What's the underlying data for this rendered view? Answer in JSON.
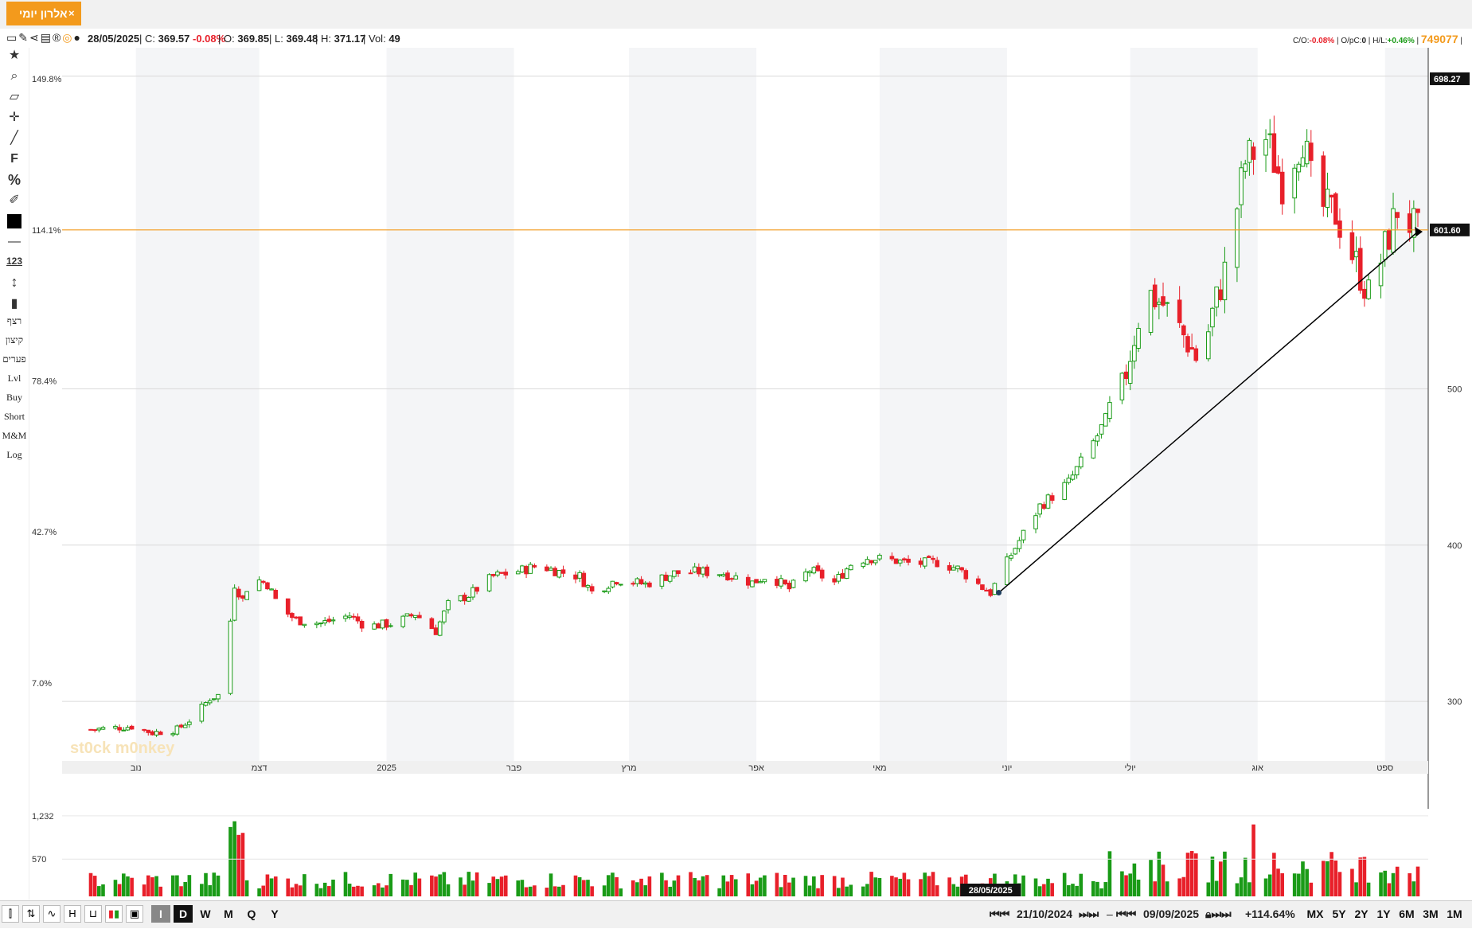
{
  "tab": {
    "title": "אלרון יומי",
    "close": "×"
  },
  "info": {
    "date": "28/05/2025",
    "close_label": "C:",
    "close": "369.57",
    "change": "-0.08%",
    "open_label": "O:",
    "open": "369.85",
    "low_label": "L:",
    "low": "369.48",
    "high_label": "H:",
    "high": "371.17",
    "vol_label": "Vol:",
    "vol": "49",
    "co_label": "C/O:",
    "co": "-0.08%",
    "opc_label": "O/pC:",
    "opc": "0",
    "hl_label": "H/L:",
    "hl": "+0.46%",
    "id": "749077"
  },
  "sidebar": {
    "text_items": [
      "רצף",
      "קיצון",
      "פערים",
      "Lvl",
      "Buy",
      "Short",
      "M&M",
      "Log"
    ],
    "icons": [
      "star-icon",
      "search-icon",
      "eraser-icon",
      "crosshair-icon",
      "line-tool-icon",
      "fibonacci-icon",
      "percent-icon",
      "edit-icon",
      "color-swatch-icon",
      "line-style-icon",
      "numbers-icon",
      "vertical-line-icon",
      "candle-style-icon"
    ],
    "labels": {
      "f": "F",
      "percent": "%",
      "num": "123"
    }
  },
  "bottom": {
    "start_date": "21/10/2024",
    "end_date": "09/09/2025",
    "sep": "–",
    "change": "+114.64%",
    "periods": [
      "MX",
      "5Y",
      "2Y",
      "1Y",
      "6M",
      "3M",
      "1M"
    ],
    "intervals": [
      "I",
      "D",
      "W",
      "M",
      "Q",
      "Y"
    ],
    "left_icons": [
      "candle-chart-icon",
      "bar-chart-icon",
      "line-chart-icon",
      "ohlc-icon",
      "hollow-candle-icon",
      "volume-colors-icon",
      "save-icon"
    ]
  },
  "colors": {
    "up": "#1a9b17",
    "down": "#e8202a",
    "accent": "#f39a1c",
    "grid": "#d9d9d9",
    "band": "#f4f5f7"
  },
  "chart_data": {
    "type": "candlestick",
    "watermark": "st0ck m0nkey",
    "y_pct_ticks": [
      "149.8%",
      "114.1%",
      "78.4%",
      "42.7%",
      "7.0%"
    ],
    "y_price_ticks": [
      700,
      500,
      400,
      300
    ],
    "ylim": [
      268,
      712
    ],
    "price_labels": {
      "last": "698.27",
      "level": "601.60"
    },
    "horizontal_line": 601.6,
    "months": [
      {
        "label": "נוב",
        "date": "2024-11-01"
      },
      {
        "label": "דצמ",
        "date": "2024-12-01"
      },
      {
        "label": "2025",
        "date": "2025-01-01"
      },
      {
        "label": "פבר",
        "date": "2025-02-01"
      },
      {
        "label": "מרץ",
        "date": "2025-03-01"
      },
      {
        "label": "אפר",
        "date": "2025-04-01"
      },
      {
        "label": "מאי",
        "date": "2025-05-01"
      },
      {
        "label": "יוני",
        "date": "2025-06-01"
      },
      {
        "label": "יולי",
        "date": "2025-07-01"
      },
      {
        "label": "אוג",
        "date": "2025-08-01"
      },
      {
        "label": "ספט",
        "date": "2025-09-01"
      }
    ],
    "close_path": [
      [
        "2024-10-21",
        282
      ],
      [
        "2024-10-31",
        284
      ],
      [
        "2024-11-05",
        280
      ],
      [
        "2024-11-11",
        282
      ],
      [
        "2024-11-15",
        290
      ],
      [
        "2024-11-19",
        302
      ],
      [
        "2024-11-22",
        305
      ],
      [
        "2024-11-25",
        375
      ],
      [
        "2024-11-27",
        365
      ],
      [
        "2024-11-29",
        380
      ],
      [
        "2024-12-03",
        375
      ],
      [
        "2024-12-06",
        360
      ],
      [
        "2024-12-10",
        352
      ],
      [
        "2024-12-16",
        350
      ],
      [
        "2024-12-23",
        355
      ],
      [
        "2024-12-27",
        348
      ],
      [
        "2025-01-03",
        350
      ],
      [
        "2025-01-08",
        356
      ],
      [
        "2025-01-13",
        345
      ],
      [
        "2025-01-16",
        362
      ],
      [
        "2025-01-21",
        368
      ],
      [
        "2025-01-27",
        380
      ],
      [
        "2025-02-03",
        384
      ],
      [
        "2025-02-07",
        387
      ],
      [
        "2025-02-12",
        383
      ],
      [
        "2025-02-17",
        380
      ],
      [
        "2025-02-20",
        370
      ],
      [
        "2025-02-26",
        378
      ],
      [
        "2025-03-05",
        375
      ],
      [
        "2025-03-12",
        382
      ],
      [
        "2025-03-18",
        383
      ],
      [
        "2025-03-24",
        382
      ],
      [
        "2025-03-31",
        376
      ],
      [
        "2025-04-04",
        381
      ],
      [
        "2025-04-09",
        372
      ],
      [
        "2025-04-14",
        384
      ],
      [
        "2025-04-20",
        376
      ],
      [
        "2025-04-24",
        388
      ],
      [
        "2025-04-28",
        392
      ],
      [
        "2025-05-05",
        390
      ],
      [
        "2025-05-09",
        388
      ],
      [
        "2025-05-15",
        389
      ],
      [
        "2025-05-20",
        385
      ],
      [
        "2025-05-26",
        373
      ],
      [
        "2025-05-28",
        369.57
      ],
      [
        "2025-06-02",
        394
      ],
      [
        "2025-06-09",
        425
      ],
      [
        "2025-06-16",
        440
      ],
      [
        "2025-06-23",
        470
      ],
      [
        "2025-06-29",
        500
      ],
      [
        "2025-07-03",
        545
      ],
      [
        "2025-07-06",
        560
      ],
      [
        "2025-07-09",
        554
      ],
      [
        "2025-07-15",
        530
      ],
      [
        "2025-07-18",
        515
      ],
      [
        "2025-07-21",
        548
      ],
      [
        "2025-07-24",
        575
      ],
      [
        "2025-07-29",
        645
      ],
      [
        "2025-08-03",
        660
      ],
      [
        "2025-08-07",
        632
      ],
      [
        "2025-08-12",
        662
      ],
      [
        "2025-08-15",
        618
      ],
      [
        "2025-08-20",
        612
      ],
      [
        "2025-08-25",
        580
      ],
      [
        "2025-08-28",
        560
      ],
      [
        "2025-09-01",
        590
      ],
      [
        "2025-09-04",
        615
      ],
      [
        "2025-09-09",
        600
      ]
    ],
    "trendline": {
      "start": [
        "2025-05-30",
        369.57
      ],
      "end": [
        "2025-09-09",
        600.5
      ]
    },
    "marker": {
      "label": "28/05/2025",
      "date": "2025-05-28"
    },
    "volume": {
      "ticks": [
        "1,232",
        "570"
      ],
      "max": 1900
    }
  }
}
